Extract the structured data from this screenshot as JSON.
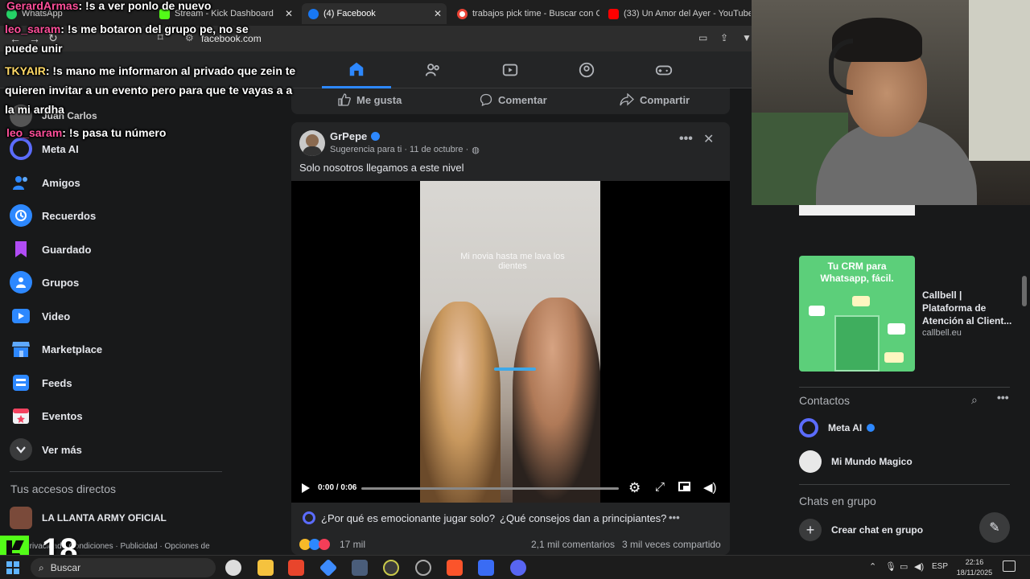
{
  "tabs": [
    {
      "label": "WhatsApp",
      "color": "#25d366"
    },
    {
      "label": "Stream - Kick Dashboard",
      "color": "#53fc18"
    },
    {
      "label": "(4) Facebook",
      "color": "#1877f2"
    },
    {
      "label": "trabajos pick time - Buscar con Go",
      "color": "#ea4335"
    },
    {
      "label": "(33) Un Amor del Ayer - YouTube",
      "color": "#ff0000"
    }
  ],
  "address": "facebook.com",
  "chat": [
    {
      "user": "GerardArmas",
      "text": ": !s a ver ponlo de nuevo"
    },
    {
      "user": "leo_saram",
      "text": ": !s me botaron del grupo pe, no se puede unir"
    },
    {
      "user": "TKYAIR",
      "text": ": !s mano me informaron al privado que zein te quieren invitar a un evento pero para que te vayas a a la mi ardha"
    },
    {
      "user": "leo_saram",
      "text": ": !s pasa tu número"
    }
  ],
  "sidebar": {
    "profile": "Juan Carlos",
    "items": [
      {
        "label": "Meta AI",
        "icon": "meta-ai-icon"
      },
      {
        "label": "Amigos",
        "icon": "friends-icon"
      },
      {
        "label": "Recuerdos",
        "icon": "memories-icon"
      },
      {
        "label": "Guardado",
        "icon": "saved-icon"
      },
      {
        "label": "Grupos",
        "icon": "groups-icon"
      },
      {
        "label": "Video",
        "icon": "video-icon"
      },
      {
        "label": "Marketplace",
        "icon": "marketplace-icon"
      },
      {
        "label": "Feeds",
        "icon": "feeds-icon"
      },
      {
        "label": "Eventos",
        "icon": "events-icon"
      },
      {
        "label": "Ver más",
        "icon": "chevron-down-icon"
      }
    ],
    "shortcuts_title": "Tus accesos directos",
    "shortcut": "LA LLANTA ARMY OFICIAL",
    "footer": "Privacidad · Condiciones · Publicidad · Opciones de"
  },
  "prev_post_actions": {
    "like": "Me gusta",
    "comment": "Comentar",
    "share": "Compartir"
  },
  "post": {
    "author": "GrPepe",
    "meta": "Sugerencia para ti · 11 de octubre ·",
    "text": "Solo nosotros llegamos a este nivel",
    "video_caption": "Mi novia hasta me lava los dientes",
    "time": "0:00 / 0:06",
    "progress": 0.0,
    "suggestions": [
      "¿Por qué es emocionante jugar solo?",
      "¿Qué consejos dan a principiantes?"
    ],
    "reactions": "17 mil",
    "comments": "2,1 mil comentarios",
    "shares": "3 mil veces compartido"
  },
  "ad": {
    "image_title": "Tu CRM para Whatsapp, fácil.",
    "title": "Callbell | Plataforma de Atención al Client...",
    "domain": "callbell.eu"
  },
  "contacts": {
    "title": "Contactos",
    "items": [
      "Meta AI",
      "Mi Mundo Magico"
    ],
    "group_title": "Chats en grupo",
    "create_group": "Crear chat en grupo"
  },
  "overlay_number": "18",
  "taskbar": {
    "search": "Buscar",
    "lang": "ESP",
    "time": "22:16",
    "date": "18/11/2025"
  },
  "colors": {
    "accent": "#2d88ff",
    "bg": "#18191a",
    "card": "#242526"
  }
}
